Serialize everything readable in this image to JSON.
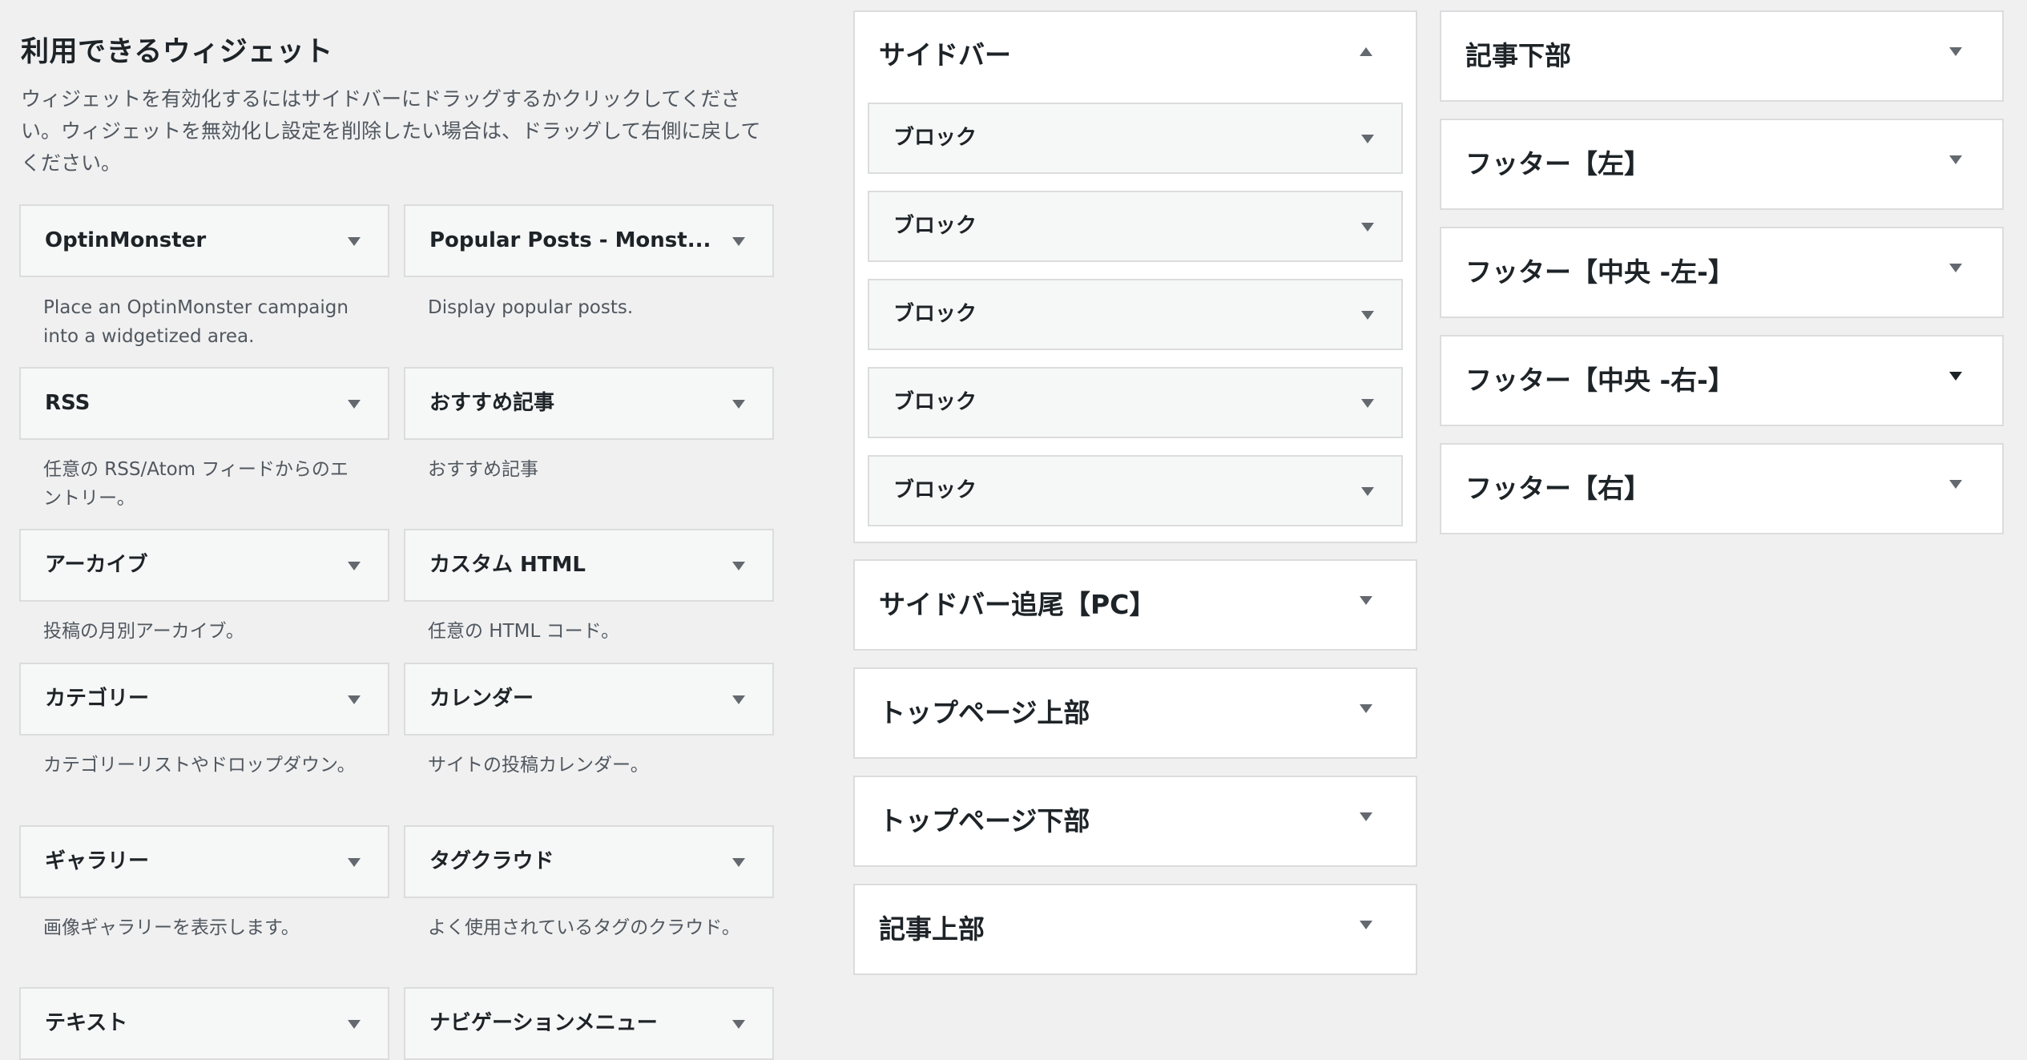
{
  "available": {
    "title": "利用できるウィジェット",
    "description": "ウィジェットを有効化するにはサイドバーにドラッグするかクリックしてください。ウィジェットを無効化し設定を削除したい場合は、ドラッグして右側に戻してください。",
    "widgets": [
      {
        "title": "OptinMonster",
        "desc": "Place an OptinMonster campaign into a widgetized area."
      },
      {
        "title": "Popular Posts - Monst...",
        "desc": "Display popular posts."
      },
      {
        "title": "RSS",
        "desc": "任意の RSS/Atom フィードからのエントリー。"
      },
      {
        "title": "おすすめ記事",
        "desc": "おすすめ記事"
      },
      {
        "title": "アーカイブ",
        "desc": "投稿の月別アーカイブ。"
      },
      {
        "title": "カスタム HTML",
        "desc": "任意の HTML コード。"
      },
      {
        "title": "カテゴリー",
        "desc": "カテゴリーリストやドロップダウン。"
      },
      {
        "title": "カレンダー",
        "desc": "サイトの投稿カレンダー。"
      },
      {
        "title": "ギャラリー",
        "desc": "画像ギャラリーを表示します。"
      },
      {
        "title": "タグクラウド",
        "desc": "よく使用されているタグのクラウド。"
      },
      {
        "title": "テキスト",
        "desc": ""
      },
      {
        "title": "ナビゲーションメニュー",
        "desc": ""
      }
    ]
  },
  "sidebar": {
    "title": "サイドバー",
    "blocks": [
      "ブロック",
      "ブロック",
      "ブロック",
      "ブロック",
      "ブロック"
    ]
  },
  "middle_areas": [
    "サイドバー追尾【PC】",
    "トップページ上部",
    "トップページ下部",
    "記事上部"
  ],
  "right_areas": [
    "記事下部",
    "フッター【左】",
    "フッター【中央 -左-】",
    "フッター【中央 -右-】",
    "フッター【右】"
  ],
  "icons": {
    "collapse": "arrow-up-icon",
    "expand": "arrow-down-icon"
  }
}
